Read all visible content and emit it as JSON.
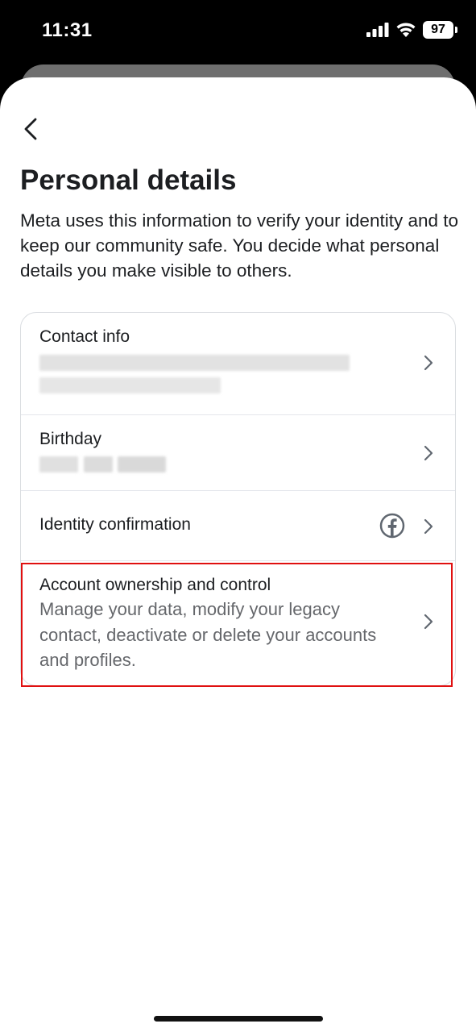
{
  "status_bar": {
    "time": "11:31",
    "battery_level": "97"
  },
  "header": {
    "back_icon": "chevron-left-icon",
    "title": "Personal details",
    "description": "Meta uses this information to verify your identity and to keep our community safe. You decide what personal details you make visible to others."
  },
  "items": [
    {
      "title": "Contact info",
      "value_redacted": true
    },
    {
      "title": "Birthday",
      "value_redacted": true
    },
    {
      "title": "Identity confirmation",
      "icon": "facebook-icon"
    },
    {
      "title": "Account ownership and control",
      "subtitle": "Manage your data, modify your legacy contact, deactivate or delete your accounts and profiles."
    }
  ],
  "colors": {
    "text_primary": "#1c1e21",
    "text_secondary": "#65676b",
    "highlight": "#e01010",
    "chevron": "#606770"
  }
}
